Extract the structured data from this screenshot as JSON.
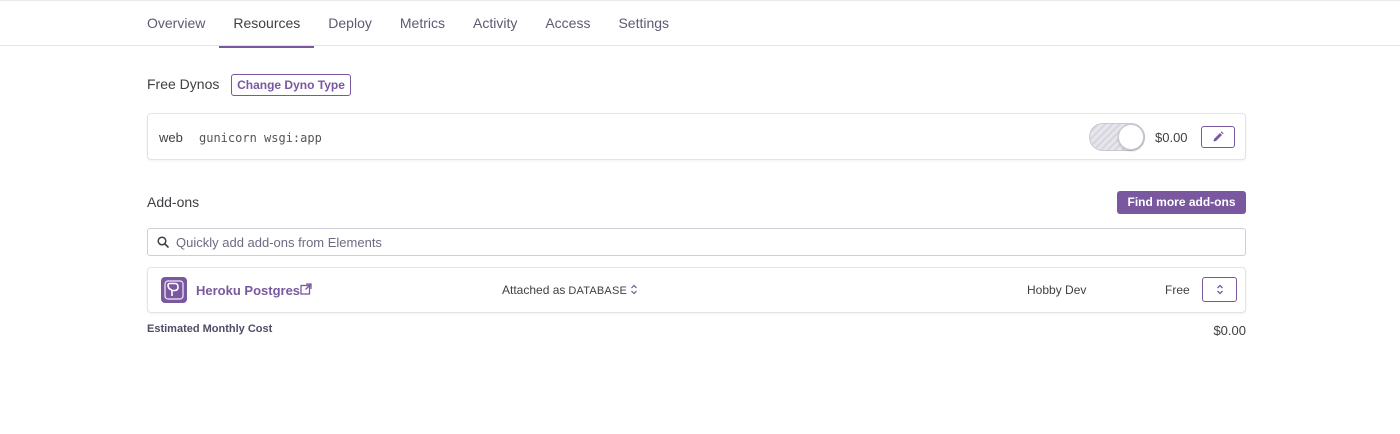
{
  "nav": {
    "tabs": [
      {
        "label": "Overview"
      },
      {
        "label": "Resources",
        "active": true
      },
      {
        "label": "Deploy"
      },
      {
        "label": "Metrics"
      },
      {
        "label": "Activity"
      },
      {
        "label": "Access"
      },
      {
        "label": "Settings"
      }
    ]
  },
  "dynos": {
    "title": "Free Dynos",
    "change_button_label": "Change Dyno Type",
    "process": {
      "name": "web",
      "command": "gunicorn wsgi:app",
      "enabled": true,
      "price": "$0.00",
      "edit_icon": "pencil-icon"
    }
  },
  "addons": {
    "title": "Add-ons",
    "find_button_label": "Find more add-ons",
    "search_placeholder": "Quickly add add-ons from Elements",
    "search_value": "",
    "items": [
      {
        "name": "Heroku Postgres",
        "logo_icon": "heroku-postgres-logo-icon",
        "attached_prefix": "Attached as",
        "attached_name": "DATABASE",
        "plan": "Hobby Dev",
        "cost": "Free"
      }
    ]
  },
  "estimate": {
    "label": "Estimated Monthly Cost",
    "value": "$0.00"
  },
  "colors": {
    "accent": "#79589f",
    "text": "#3f3f44",
    "border": "#e3e3ea"
  }
}
